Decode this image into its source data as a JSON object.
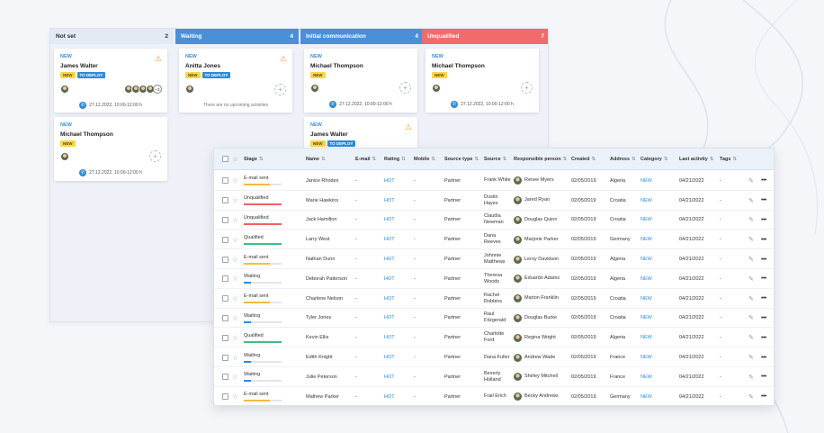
{
  "kanban": {
    "columns": [
      {
        "title": "Not set",
        "count": "2",
        "color": "#e7eef8",
        "text_color": "#2b2f38"
      },
      {
        "title": "Waiting",
        "count": "4",
        "color": "#4a90d9",
        "text_color": "#ffffff"
      },
      {
        "title": "Initial communication",
        "count": "4",
        "color": "#4a90d9",
        "text_color": "#ffffff"
      },
      {
        "title": "Unqualified",
        "count": "7",
        "color": "#f26b6b",
        "text_color": "#ffffff"
      }
    ],
    "cards": {
      "c1": {
        "new": "NEW",
        "name": "James Walter",
        "tag_new": "NEW",
        "tag_deploy": "TO DEPLOY",
        "more": "+3",
        "time": "27.12.2022, 10:00-12:00 h"
      },
      "c2": {
        "new": "NEW",
        "name": "Michael Thompson",
        "tag_new": "NEW",
        "time": "27.12.2022, 10:00-12:00 h"
      },
      "c3": {
        "new": "NEW",
        "name": "Anitta Jones",
        "tag_new": "NEW",
        "tag_deploy": "TO DEPLOY",
        "no_activity": "There are no upcoming activities"
      },
      "c4": {
        "new": "NEW",
        "name": "Michael Thompson",
        "tag_new": "NEW",
        "time": "27.12.2022, 10:00-12:00 h"
      },
      "c5": {
        "new": "NEW",
        "name": "James Walter",
        "tag_new": "NEW",
        "tag_deploy": "TO DEPLOY"
      },
      "c6": {
        "new": "NEW",
        "name": "Michael Thompson",
        "tag_new": "NEW",
        "time": "27.12.2022, 10:00-12:00 h"
      }
    }
  },
  "table": {
    "headers": {
      "stage": "Stage",
      "name": "Name",
      "email": "E-mail",
      "rating": "Rating",
      "mobile": "Mobile",
      "source_type": "Source type",
      "source": "Source",
      "person": "Responsible person",
      "created": "Created",
      "address": "Address",
      "category": "Category",
      "last_activity": "Last activity",
      "tags": "Tags"
    },
    "stage_colors": {
      "E-mail sent": "#f5b940",
      "Unqualified": "#f06262",
      "Qualified": "#3fbf7f",
      "Waiting": "#2e8bd8"
    },
    "stage_fill": {
      "E-mail sent": 0.7,
      "Unqualified": 1.0,
      "Qualified": 1.0,
      "Waiting": 0.2
    },
    "rows": [
      {
        "stage": "E-mail sent",
        "name": "Janice Rhodes",
        "email": "-",
        "rating": "HOT",
        "mobile": "-",
        "source_type": "Partner",
        "source": "Frank White",
        "person": "Renee Myers",
        "created": "02/05/2019",
        "address": "Algeria",
        "category": "NEW",
        "last_activity": "04/21/2022",
        "tags": "-"
      },
      {
        "stage": "Unqualified",
        "name": "Marie Hawkins",
        "email": "-",
        "rating": "HOT",
        "mobile": "-",
        "source_type": "Partner",
        "source": "Dustin Hayes",
        "person": "Jared Ryan",
        "created": "02/05/2019",
        "address": "Croatia",
        "category": "NEW",
        "last_activity": "04/21/2022",
        "tags": "-"
      },
      {
        "stage": "Unqualified",
        "name": "Jack Hamilton",
        "email": "-",
        "rating": "HOT",
        "mobile": "-",
        "source_type": "Partner",
        "source": "Claudia Newman",
        "person": "Douglas Quinn",
        "created": "02/05/2019",
        "address": "Croatia",
        "category": "NEW",
        "last_activity": "04/21/2022",
        "tags": "-"
      },
      {
        "stage": "Qualified",
        "name": "Larry West",
        "email": "-",
        "rating": "HOT",
        "mobile": "-",
        "source_type": "Partner",
        "source": "Dana Reeves",
        "person": "Marjorie Parker",
        "created": "02/05/2019",
        "address": "Germany",
        "category": "NEW",
        "last_activity": "04/21/2022",
        "tags": "-"
      },
      {
        "stage": "E-mail sent",
        "name": "Nathan Dunn",
        "email": "-",
        "rating": "HOT",
        "mobile": "-",
        "source_type": "Partner",
        "source": "Johnnie Matthews",
        "person": "Leroy Davidson",
        "created": "02/05/2019",
        "address": "Algeria",
        "category": "NEW",
        "last_activity": "04/21/2022",
        "tags": "-"
      },
      {
        "stage": "Waiting",
        "name": "Deborah Patterson",
        "email": "-",
        "rating": "HOT",
        "mobile": "-",
        "source_type": "Partner",
        "source": "Theresa Woods",
        "person": "Eduardo Adams",
        "created": "02/05/2019",
        "address": "Algeria",
        "category": "NEW",
        "last_activity": "04/21/2022",
        "tags": "-"
      },
      {
        "stage": "E-mail sent",
        "name": "Charlene Nelson",
        "email": "-",
        "rating": "HOT",
        "mobile": "-",
        "source_type": "Partner",
        "source": "Rachel Robbins",
        "person": "Marion Franklin",
        "created": "02/05/2019",
        "address": "Croatia",
        "category": "NEW",
        "last_activity": "04/21/2022",
        "tags": "-"
      },
      {
        "stage": "Waiting",
        "name": "Tyler Jones",
        "email": "-",
        "rating": "HOT",
        "mobile": "-",
        "source_type": "Partner",
        "source": "Raul Fitzgerald",
        "person": "Douglas Burke",
        "created": "02/05/2019",
        "address": "Croatia",
        "category": "NEW",
        "last_activity": "04/21/2022",
        "tags": "-"
      },
      {
        "stage": "Qualified",
        "name": "Kevin Ellis",
        "email": "-",
        "rating": "HOT",
        "mobile": "-",
        "source_type": "Partner",
        "source": "Charlotte Ford",
        "person": "Regina Wright",
        "created": "02/05/2019",
        "address": "Algeria",
        "category": "NEW",
        "last_activity": "04/21/2022",
        "tags": "-"
      },
      {
        "stage": "Waiting",
        "name": "Edith Knight",
        "email": "-",
        "rating": "HOT",
        "mobile": "-",
        "source_type": "Partner",
        "source": "Dana Fuller",
        "person": "Andrew Wade",
        "created": "02/05/2019",
        "address": "France",
        "category": "NEW",
        "last_activity": "04/21/2022",
        "tags": "-"
      },
      {
        "stage": "Waiting",
        "name": "Julie Peterson",
        "email": "-",
        "rating": "HOT",
        "mobile": "-",
        "source_type": "Partner",
        "source": "Beverly Holland",
        "person": "Shirley Mitchell",
        "created": "02/05/2019",
        "address": "France",
        "category": "NEW",
        "last_activity": "04/21/2022",
        "tags": "-"
      },
      {
        "stage": "E-mail sent",
        "name": "Mathew Parker",
        "email": "-",
        "rating": "HOT",
        "mobile": "-",
        "source_type": "Partner",
        "source": "Frail Erich",
        "person": "Becky Andrews",
        "created": "02/05/2019",
        "address": "Germany",
        "category": "NEW",
        "last_activity": "04/21/2022",
        "tags": "-"
      }
    ]
  }
}
